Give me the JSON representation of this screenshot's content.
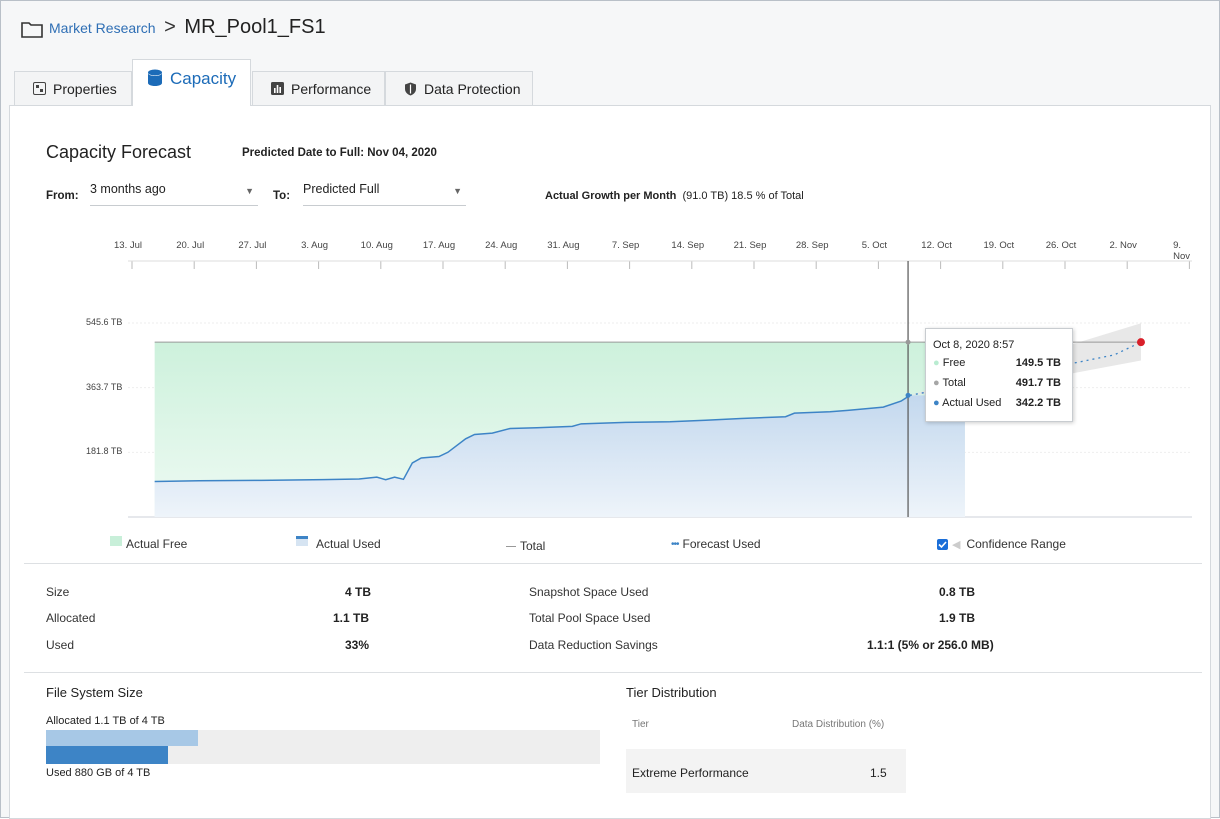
{
  "breadcrumb": {
    "parent": "Market Research",
    "separator": ">",
    "current": "MR_Pool1_FS1"
  },
  "tabs": [
    {
      "label": "Properties",
      "icon": "properties-icon"
    },
    {
      "label": "Capacity",
      "icon": "database-icon"
    },
    {
      "label": "Performance",
      "icon": "bar-chart-icon"
    },
    {
      "label": "Data Protection",
      "icon": "shield-icon"
    }
  ],
  "forecast": {
    "title": "Capacity Forecast",
    "predicted_label": "Predicted Date to Full:",
    "predicted_value": "Nov 04, 2020",
    "from_label": "From:",
    "from_value": "3 months ago",
    "to_label": "To:",
    "to_value": "Predicted Full",
    "growth_label": "Actual Growth per Month",
    "growth_value": "(91.0 TB) 18.5 % of Total"
  },
  "chart_data": {
    "type": "area",
    "x_ticks": [
      "13. Jul",
      "20. Jul",
      "27. Jul",
      "3. Aug",
      "10. Aug",
      "17. Aug",
      "24. Aug",
      "31. Aug",
      "7. Sep",
      "14. Sep",
      "21. Sep",
      "28. Sep",
      "5. Oct",
      "12. Oct",
      "19. Oct",
      "26. Oct",
      "2. Nov",
      "9. Nov"
    ],
    "y_ticks": [
      "545.6 TB",
      "363.7 TB",
      "181.8 TB"
    ],
    "ylim": [
      0,
      545.6
    ],
    "total_tb": 491.7,
    "series": [
      {
        "name": "Actual Free",
        "color": "#c8efd9"
      },
      {
        "name": "Actual Used",
        "color": "#3d84c6"
      },
      {
        "name": "Total",
        "color": "#999999"
      },
      {
        "name": "Forecast Used",
        "color": "#3d84c6"
      }
    ],
    "actual_used": [
      [
        "2020-07-16",
        100
      ],
      [
        "2020-07-21",
        102
      ],
      [
        "2020-07-28",
        103
      ],
      [
        "2020-08-04",
        105
      ],
      [
        "2020-08-08",
        107
      ],
      [
        "2020-08-10",
        112
      ],
      [
        "2020-08-11",
        105
      ],
      [
        "2020-08-12",
        112
      ],
      [
        "2020-08-13",
        106
      ],
      [
        "2020-08-14",
        152
      ],
      [
        "2020-08-15",
        166
      ],
      [
        "2020-08-17",
        170
      ],
      [
        "2020-08-18",
        182
      ],
      [
        "2020-08-20",
        220
      ],
      [
        "2020-08-21",
        232
      ],
      [
        "2020-08-23",
        236
      ],
      [
        "2020-08-25",
        249
      ],
      [
        "2020-08-28",
        251
      ],
      [
        "2020-09-01",
        255
      ],
      [
        "2020-09-02",
        262
      ],
      [
        "2020-09-07",
        266
      ],
      [
        "2020-09-12",
        268
      ],
      [
        "2020-09-16",
        272
      ],
      [
        "2020-09-20",
        277
      ],
      [
        "2020-09-25",
        282
      ],
      [
        "2020-09-26",
        292
      ],
      [
        "2020-09-30",
        296
      ],
      [
        "2020-10-02",
        300
      ],
      [
        "2020-10-06",
        309
      ],
      [
        "2020-10-08",
        326
      ],
      [
        "2020-10-09",
        342
      ]
    ],
    "forecast_used": [
      [
        "2020-10-09",
        342.2
      ],
      [
        "2020-10-20",
        395
      ],
      [
        "2020-11-01",
        456
      ],
      [
        "2020-11-04",
        491.7
      ]
    ],
    "confidence_upper": [
      [
        "2020-10-09",
        342
      ],
      [
        "2020-10-20",
        430
      ],
      [
        "2020-11-04",
        545
      ]
    ],
    "confidence_lower": [
      [
        "2020-10-09",
        342
      ],
      [
        "2020-10-20",
        370
      ],
      [
        "2020-11-04",
        440
      ]
    ],
    "cursor_date": "2020-10-08",
    "full_point": [
      "2020-11-04",
      491.7
    ]
  },
  "tooltip": {
    "date": "Oct 8, 2020 8:57",
    "rows": [
      {
        "label": "Free",
        "value": "149.5 TB",
        "color": "#b9ecd1"
      },
      {
        "label": "Total",
        "value": "491.7 TB",
        "color": "#a6a6a6"
      },
      {
        "label": "Actual Used",
        "value": "342.2 TB",
        "color": "#3d84c6"
      }
    ]
  },
  "legend": {
    "actual_free": "Actual Free",
    "actual_used": "Actual Used",
    "total": "Total",
    "forecast_used": "Forecast Used",
    "confidence_range": "Confidence Range",
    "confidence_checked": true
  },
  "stats": {
    "size_label": "Size",
    "size_value": "4 TB",
    "allocated_label": "Allocated",
    "allocated_value": "1.1 TB",
    "used_label": "Used",
    "used_value": "33%",
    "snapshot_label": "Snapshot Space Used",
    "snapshot_value": "0.8 TB",
    "pool_label": "Total Pool Space Used",
    "pool_value": "1.9 TB",
    "reduction_label": "Data Reduction Savings",
    "reduction_value": "1.1:1 (5% or 256.0 MB)"
  },
  "fs_size": {
    "title": "File System Size",
    "allocated_text": "Allocated 1.1 TB of 4 TB",
    "used_text": "Used 880 GB of 4 TB",
    "allocated_fraction": 0.275,
    "used_fraction": 0.22
  },
  "tier": {
    "title": "Tier Distribution",
    "col_tier": "Tier",
    "col_dist": "Data Distribution (%)",
    "rows": [
      {
        "tier": "Extreme Performance",
        "dist": "1.5"
      }
    ]
  }
}
